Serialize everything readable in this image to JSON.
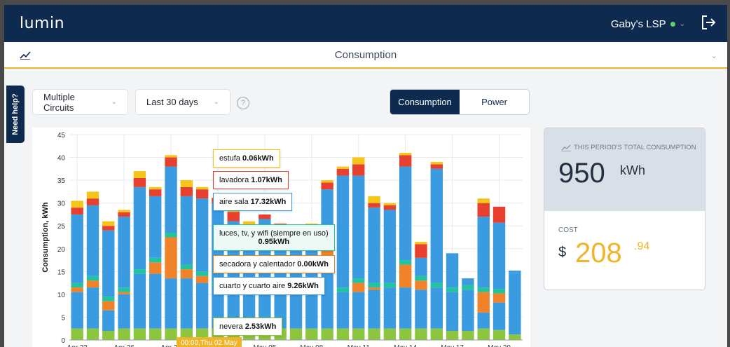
{
  "app": {
    "logo": "lumin",
    "account": "Gaby's LSP"
  },
  "subbar": {
    "title": "Consumption"
  },
  "help_tab": "Need help?",
  "filters": {
    "circuits": "Multiple Circuits",
    "range": "Last 30 days",
    "help_glyph": "?"
  },
  "toggle": {
    "consumption": "Consumption",
    "power": "Power",
    "active": "Consumption"
  },
  "summary": {
    "total_label": "THIS PERIOD'S TOTAL CONSUMPTION",
    "total_value": "950",
    "total_unit": "kWh",
    "cost_label": "COST",
    "currency": "$",
    "cost_value": "208",
    "cost_cents": ".94"
  },
  "tooltip": {
    "date_tag": "00:00,Thu 02 May",
    "items": [
      {
        "name": "estufa",
        "value": "0.06kWh",
        "color": "#f5c518"
      },
      {
        "name": "lavadora",
        "value": "1.07kWh",
        "color": "#e8402e"
      },
      {
        "name": "aire sala",
        "value": "17.32kWh",
        "color": "#3b9be0"
      },
      {
        "name": "luces, tv, y wifi (siempre en uso)",
        "value": "0.95kWh",
        "color": "#22c4a0"
      },
      {
        "name": "secadora y calentador",
        "value": "0.00kWh",
        "color": "#f0832a"
      },
      {
        "name": "cuarto y cuarto aire",
        "value": "9.26kWh",
        "color": "#3b9be0"
      },
      {
        "name": "nevera",
        "value": "2.53kWh",
        "color": "#8cc63f"
      }
    ]
  },
  "chart_data": {
    "type": "bar",
    "stacked": true,
    "ylabel": "Consumption, kWh",
    "ylim": [
      0,
      45
    ],
    "yticks": [
      0,
      5,
      10,
      15,
      20,
      25,
      30,
      35,
      40,
      45
    ],
    "xtick_labels": [
      "Apr 23",
      "Apr 26",
      "Apr 29",
      "May 02",
      "May 05",
      "May 08",
      "May 11",
      "May 14",
      "May 17",
      "May 20"
    ],
    "grid": true,
    "colors": {
      "nevera": "#8cc63f",
      "cuarto": "#3b9be0",
      "secadora": "#f0832a",
      "luces": "#22c4a0",
      "aire": "#3b9be0",
      "lavadora": "#e8402e",
      "estufa": "#f5c518"
    },
    "series": [
      {
        "name": "nevera",
        "values": [
          2.5,
          2.5,
          2.0,
          2.5,
          2.5,
          2.5,
          2.5,
          2.5,
          2.5,
          2.5,
          2.53,
          2.5,
          2.5,
          2.5,
          2.5,
          2.5,
          2.5,
          2.5,
          2.5,
          2.5,
          2.5,
          2.5,
          2.5,
          2.5,
          2.0,
          2.0,
          2.5,
          2.2,
          1.2
        ]
      },
      {
        "name": "cuarto y cuarto aire",
        "values": [
          8.0,
          9.0,
          4.5,
          7.5,
          12.0,
          12.0,
          11.0,
          11.0,
          10.0,
          9.26,
          10.0,
          9.0,
          8.0,
          8.5,
          8.5,
          7.5,
          12.5,
          8.0,
          8.0,
          8.5,
          9.0,
          9.0,
          8.5,
          9.0,
          8.5,
          9.0,
          3.5,
          6.0,
          13.5
        ]
      },
      {
        "name": "secadora y calentador",
        "values": [
          1.0,
          1.5,
          2.0,
          0.5,
          0.0,
          2.5,
          9.0,
          2.0,
          1.5,
          0.0,
          0.0,
          0.0,
          0.0,
          0.0,
          0.0,
          0.0,
          8.0,
          0.0,
          2.0,
          0.5,
          0.0,
          5.0,
          2.0,
          0.0,
          0.0,
          0.0,
          4.5,
          2.0,
          0.0
        ]
      },
      {
        "name": "luces, tv, y wifi (siempre en uso)",
        "values": [
          1.0,
          1.0,
          1.0,
          1.0,
          1.0,
          1.0,
          1.0,
          1.0,
          1.0,
          0.95,
          1.0,
          1.0,
          1.0,
          1.0,
          1.0,
          1.0,
          1.0,
          1.0,
          1.0,
          1.0,
          1.0,
          1.0,
          1.0,
          1.0,
          1.0,
          1.0,
          1.0,
          1.0,
          0.0
        ]
      },
      {
        "name": "aire sala",
        "values": [
          15.0,
          15.5,
          14.5,
          15.5,
          18.0,
          13.5,
          14.5,
          15.0,
          16.0,
          17.32,
          12.5,
          11.0,
          15.0,
          12.5,
          11.5,
          13.0,
          9.0,
          24.5,
          22.5,
          16.5,
          16.0,
          20.5,
          4.0,
          25.0,
          7.5,
          1.5,
          15.5,
          14.5,
          0.5
        ]
      },
      {
        "name": "lavadora",
        "values": [
          1.5,
          1.5,
          1.0,
          1.0,
          2.0,
          1.5,
          2.0,
          2.0,
          2.0,
          1.07,
          2.0,
          1.5,
          1.0,
          1.0,
          1.0,
          1.0,
          1.5,
          1.5,
          2.5,
          1.0,
          1.0,
          2.5,
          3.0,
          1.0,
          0.0,
          0.0,
          3.0,
          3.5,
          0.0
        ]
      },
      {
        "name": "estufa",
        "values": [
          1.5,
          1.5,
          1.0,
          0.5,
          1.5,
          0.5,
          0.5,
          1.5,
          0.5,
          0.06,
          0.5,
          1.0,
          0.0,
          0.0,
          0.5,
          0.5,
          0.5,
          0.5,
          1.5,
          1.5,
          0.5,
          0.5,
          0.5,
          0.5,
          0.0,
          0.0,
          1.0,
          0.0,
          0.0
        ]
      }
    ]
  }
}
